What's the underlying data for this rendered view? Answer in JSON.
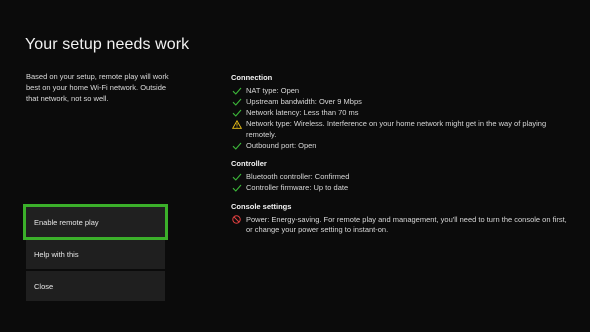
{
  "title": "Your setup needs work",
  "description": "Based on your setup, remote play will work best on your home Wi-Fi network. Outside that network, not so well.",
  "actions": [
    {
      "label": "Enable remote play",
      "focused": true
    },
    {
      "label": "Help with this",
      "focused": false
    },
    {
      "label": "Close",
      "focused": false
    }
  ],
  "sections": [
    {
      "title": "Connection",
      "items": [
        {
          "status": "ok",
          "icon": "check-icon",
          "text": "NAT type: Open"
        },
        {
          "status": "ok",
          "icon": "check-icon",
          "text": "Upstream bandwidth: Over 9 Mbps"
        },
        {
          "status": "ok",
          "icon": "check-icon",
          "text": "Network latency: Less than 70 ms"
        },
        {
          "status": "warning",
          "icon": "warning-icon",
          "text": "Network type: Wireless. Interference on your home network might get in the way of playing remotely."
        },
        {
          "status": "ok",
          "icon": "check-icon",
          "text": "Outbound port: Open"
        }
      ]
    },
    {
      "title": "Controller",
      "items": [
        {
          "status": "ok",
          "icon": "check-icon",
          "text": "Bluetooth controller: Confirmed"
        },
        {
          "status": "ok",
          "icon": "check-icon",
          "text": "Controller firmware: Up to date"
        }
      ]
    },
    {
      "title": "Console settings",
      "items": [
        {
          "status": "error",
          "icon": "blocked-icon",
          "text": "Power: Energy-saving. For remote play and management, you'll need to turn the console on first, or change your power setting to instant-on."
        }
      ]
    }
  ],
  "colors": {
    "focus": "#3bb02a",
    "ok": "#3db83a",
    "warning": "#f0c419",
    "error": "#e04040"
  }
}
